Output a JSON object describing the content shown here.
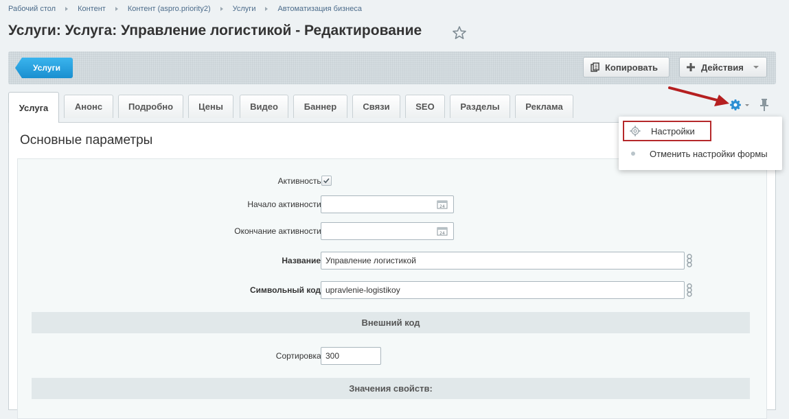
{
  "breadcrumb": [
    "Рабочий стол",
    "Контент",
    "Контент (aspro.priority2)",
    "Услуги",
    "Автоматизация бизнеса"
  ],
  "page_title": "Услуги: Услуга: Управление логистикой - Редактирование",
  "toolbar": {
    "back_label": "Услуги",
    "copy_label": "Копировать",
    "actions_label": "Действия"
  },
  "tabs": [
    {
      "label": "Услуга",
      "active": true
    },
    {
      "label": "Анонс"
    },
    {
      "label": "Подробно"
    },
    {
      "label": "Цены"
    },
    {
      "label": "Видео"
    },
    {
      "label": "Баннер"
    },
    {
      "label": "Связи"
    },
    {
      "label": "SEO"
    },
    {
      "label": "Разделы"
    },
    {
      "label": "Реклама"
    }
  ],
  "section_title": "Основные параметры",
  "form": {
    "active_label": "Активность:",
    "active_checked": true,
    "start_label": "Начало активности:",
    "start_value": "",
    "end_label": "Окончание активности:",
    "end_value": "",
    "name_label": "Название:",
    "name_value": "Управление логистикой",
    "code_label": "Символьный код:",
    "code_value": "upravlenie-logistikoy",
    "external_code_header": "Внешний код",
    "sort_label": "Сортировка:",
    "sort_value": "300",
    "properties_header": "Значения свойств:"
  },
  "menu": {
    "settings_label": "Настройки",
    "reset_label": "Отменить настройки формы"
  },
  "colors": {
    "accent_blue": "#1a8fd0",
    "highlight_red": "#b5282a"
  }
}
